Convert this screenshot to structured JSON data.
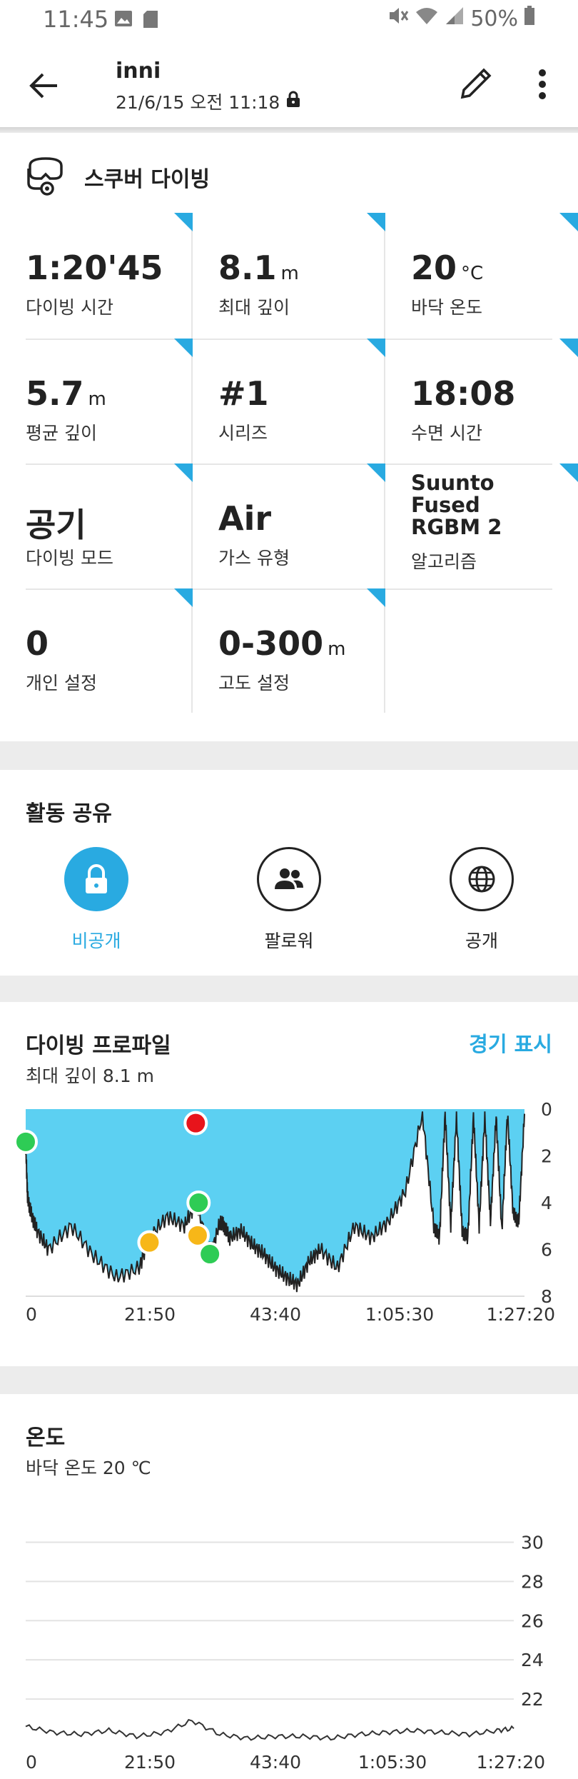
{
  "status_bar": {
    "time": "11:45",
    "battery": "50%",
    "icons": [
      "image-icon",
      "sd-card-icon",
      "mute-icon",
      "wifi-icon",
      "signal-icon",
      "battery-icon"
    ]
  },
  "app_bar": {
    "title": "inni",
    "subtitle": "21/6/15 오전 11:18",
    "icons": [
      "back-arrow-icon",
      "lock-icon",
      "pencil-icon",
      "more-vert-icon"
    ]
  },
  "summary": {
    "activity": "스쿠버 다이빙",
    "activity_icon": "scuba-mask-icon",
    "accent_color": "#29aae1",
    "cells": [
      {
        "value": "1:20'45",
        "unit": "",
        "label": "다이빙 시간"
      },
      {
        "value": "8.1",
        "unit": "m",
        "label": "최대 깊이"
      },
      {
        "value": "20",
        "unit": "°C",
        "label": "바닥 온도"
      },
      {
        "value": "5.7",
        "unit": "m",
        "label": "평균 깊이"
      },
      {
        "value": "#1",
        "unit": "",
        "label": "시리즈"
      },
      {
        "value": "18:08",
        "unit": "",
        "label": "수면 시간"
      },
      {
        "value": "공기",
        "unit": "",
        "label": "다이빙 모드"
      },
      {
        "value": "Air",
        "unit": "",
        "label": "가스 유형"
      },
      {
        "value": "Suunto Fused RGBM 2",
        "unit": "",
        "label": "알고리즘"
      },
      {
        "value": "0",
        "unit": "",
        "label": "개인 설정"
      },
      {
        "value": "0-300",
        "unit": "m",
        "label": "고도 설정"
      }
    ]
  },
  "share": {
    "title": "활동 공유",
    "options": [
      {
        "label": "비공개",
        "icon": "lock-icon",
        "selected": true
      },
      {
        "label": "팔로워",
        "icon": "followers-icon",
        "selected": false
      },
      {
        "label": "공개",
        "icon": "globe-icon",
        "selected": false
      }
    ]
  },
  "profile": {
    "title": "다이빙 프로파일",
    "subtitle": "최대 깊이 8.1 m",
    "action": "경기 표시",
    "chart_data": {
      "type": "area",
      "fill_color": "#5cd0f2",
      "x_ticks": [
        "0",
        "21:50",
        "43:40",
        "1:05:30",
        "1:27:20"
      ],
      "y_ticks": [
        "0",
        "2",
        "4",
        "6",
        "8"
      ],
      "ylim": [
        0,
        8
      ],
      "y_inverted": true,
      "x_seconds": [
        0,
        20,
        60,
        120,
        240,
        480,
        720,
        960,
        1200,
        1310,
        1500,
        1680,
        1800,
        1960,
        2060,
        2100,
        2160,
        2280,
        2400,
        2520,
        2640,
        2760,
        2880,
        3000,
        3120,
        3300,
        3480,
        3660,
        3840,
        4020,
        4200,
        4320,
        4380,
        4440,
        4500,
        4560,
        4620,
        4680,
        4740,
        4800,
        4860,
        4920,
        4980,
        5040,
        5100,
        5160,
        5220,
        5280
      ],
      "depth_m": [
        1.5,
        3.8,
        4.5,
        5.2,
        6.0,
        5.0,
        6.3,
        7.2,
        6.8,
        5.5,
        4.6,
        5.0,
        4.0,
        6.2,
        4.8,
        5.0,
        5.5,
        5.2,
        5.8,
        6.2,
        6.8,
        7.2,
        7.5,
        6.5,
        6.0,
        6.8,
        5.0,
        5.5,
        4.8,
        3.5,
        0.2,
        5.0,
        5.5,
        0.2,
        5.0,
        0.3,
        5.2,
        5.5,
        0.3,
        5.0,
        0.3,
        4.8,
        0.3,
        5.2,
        0.2,
        4.5,
        4.8,
        0.2
      ],
      "event_markers": [
        {
          "x_seconds": 0,
          "depth_m": 1.4,
          "color": "green"
        },
        {
          "x_seconds": 1800,
          "depth_m": 0.6,
          "color": "red"
        },
        {
          "x_seconds": 1830,
          "depth_m": 4.0,
          "color": "green"
        },
        {
          "x_seconds": 1820,
          "depth_m": 5.4,
          "color": "orange"
        },
        {
          "x_seconds": 1310,
          "depth_m": 5.7,
          "color": "orange"
        },
        {
          "x_seconds": 1950,
          "depth_m": 6.2,
          "color": "green"
        }
      ]
    }
  },
  "temperature": {
    "title": "온도",
    "subtitle": "바닥 온도 20 ℃",
    "chart_data": {
      "type": "line",
      "x_ticks": [
        "0",
        "21:50",
        "43:40",
        "1:05:30",
        "1:27:20"
      ],
      "y_ticks": [
        "30",
        "28",
        "26",
        "24",
        "22"
      ],
      "ylim": [
        20,
        31
      ],
      "x_seconds": [
        0,
        300,
        600,
        900,
        1200,
        1500,
        1800,
        2100,
        2400,
        2700,
        3000,
        3300,
        3600,
        3900,
        4200,
        4500,
        4800,
        5100,
        5280
      ],
      "temp_c": [
        20.6,
        20.3,
        20.2,
        20.4,
        20.1,
        20.3,
        20.9,
        20.2,
        20.0,
        20.1,
        20.1,
        20.0,
        20.2,
        20.3,
        20.4,
        20.3,
        20.2,
        20.4,
        20.5
      ]
    }
  }
}
